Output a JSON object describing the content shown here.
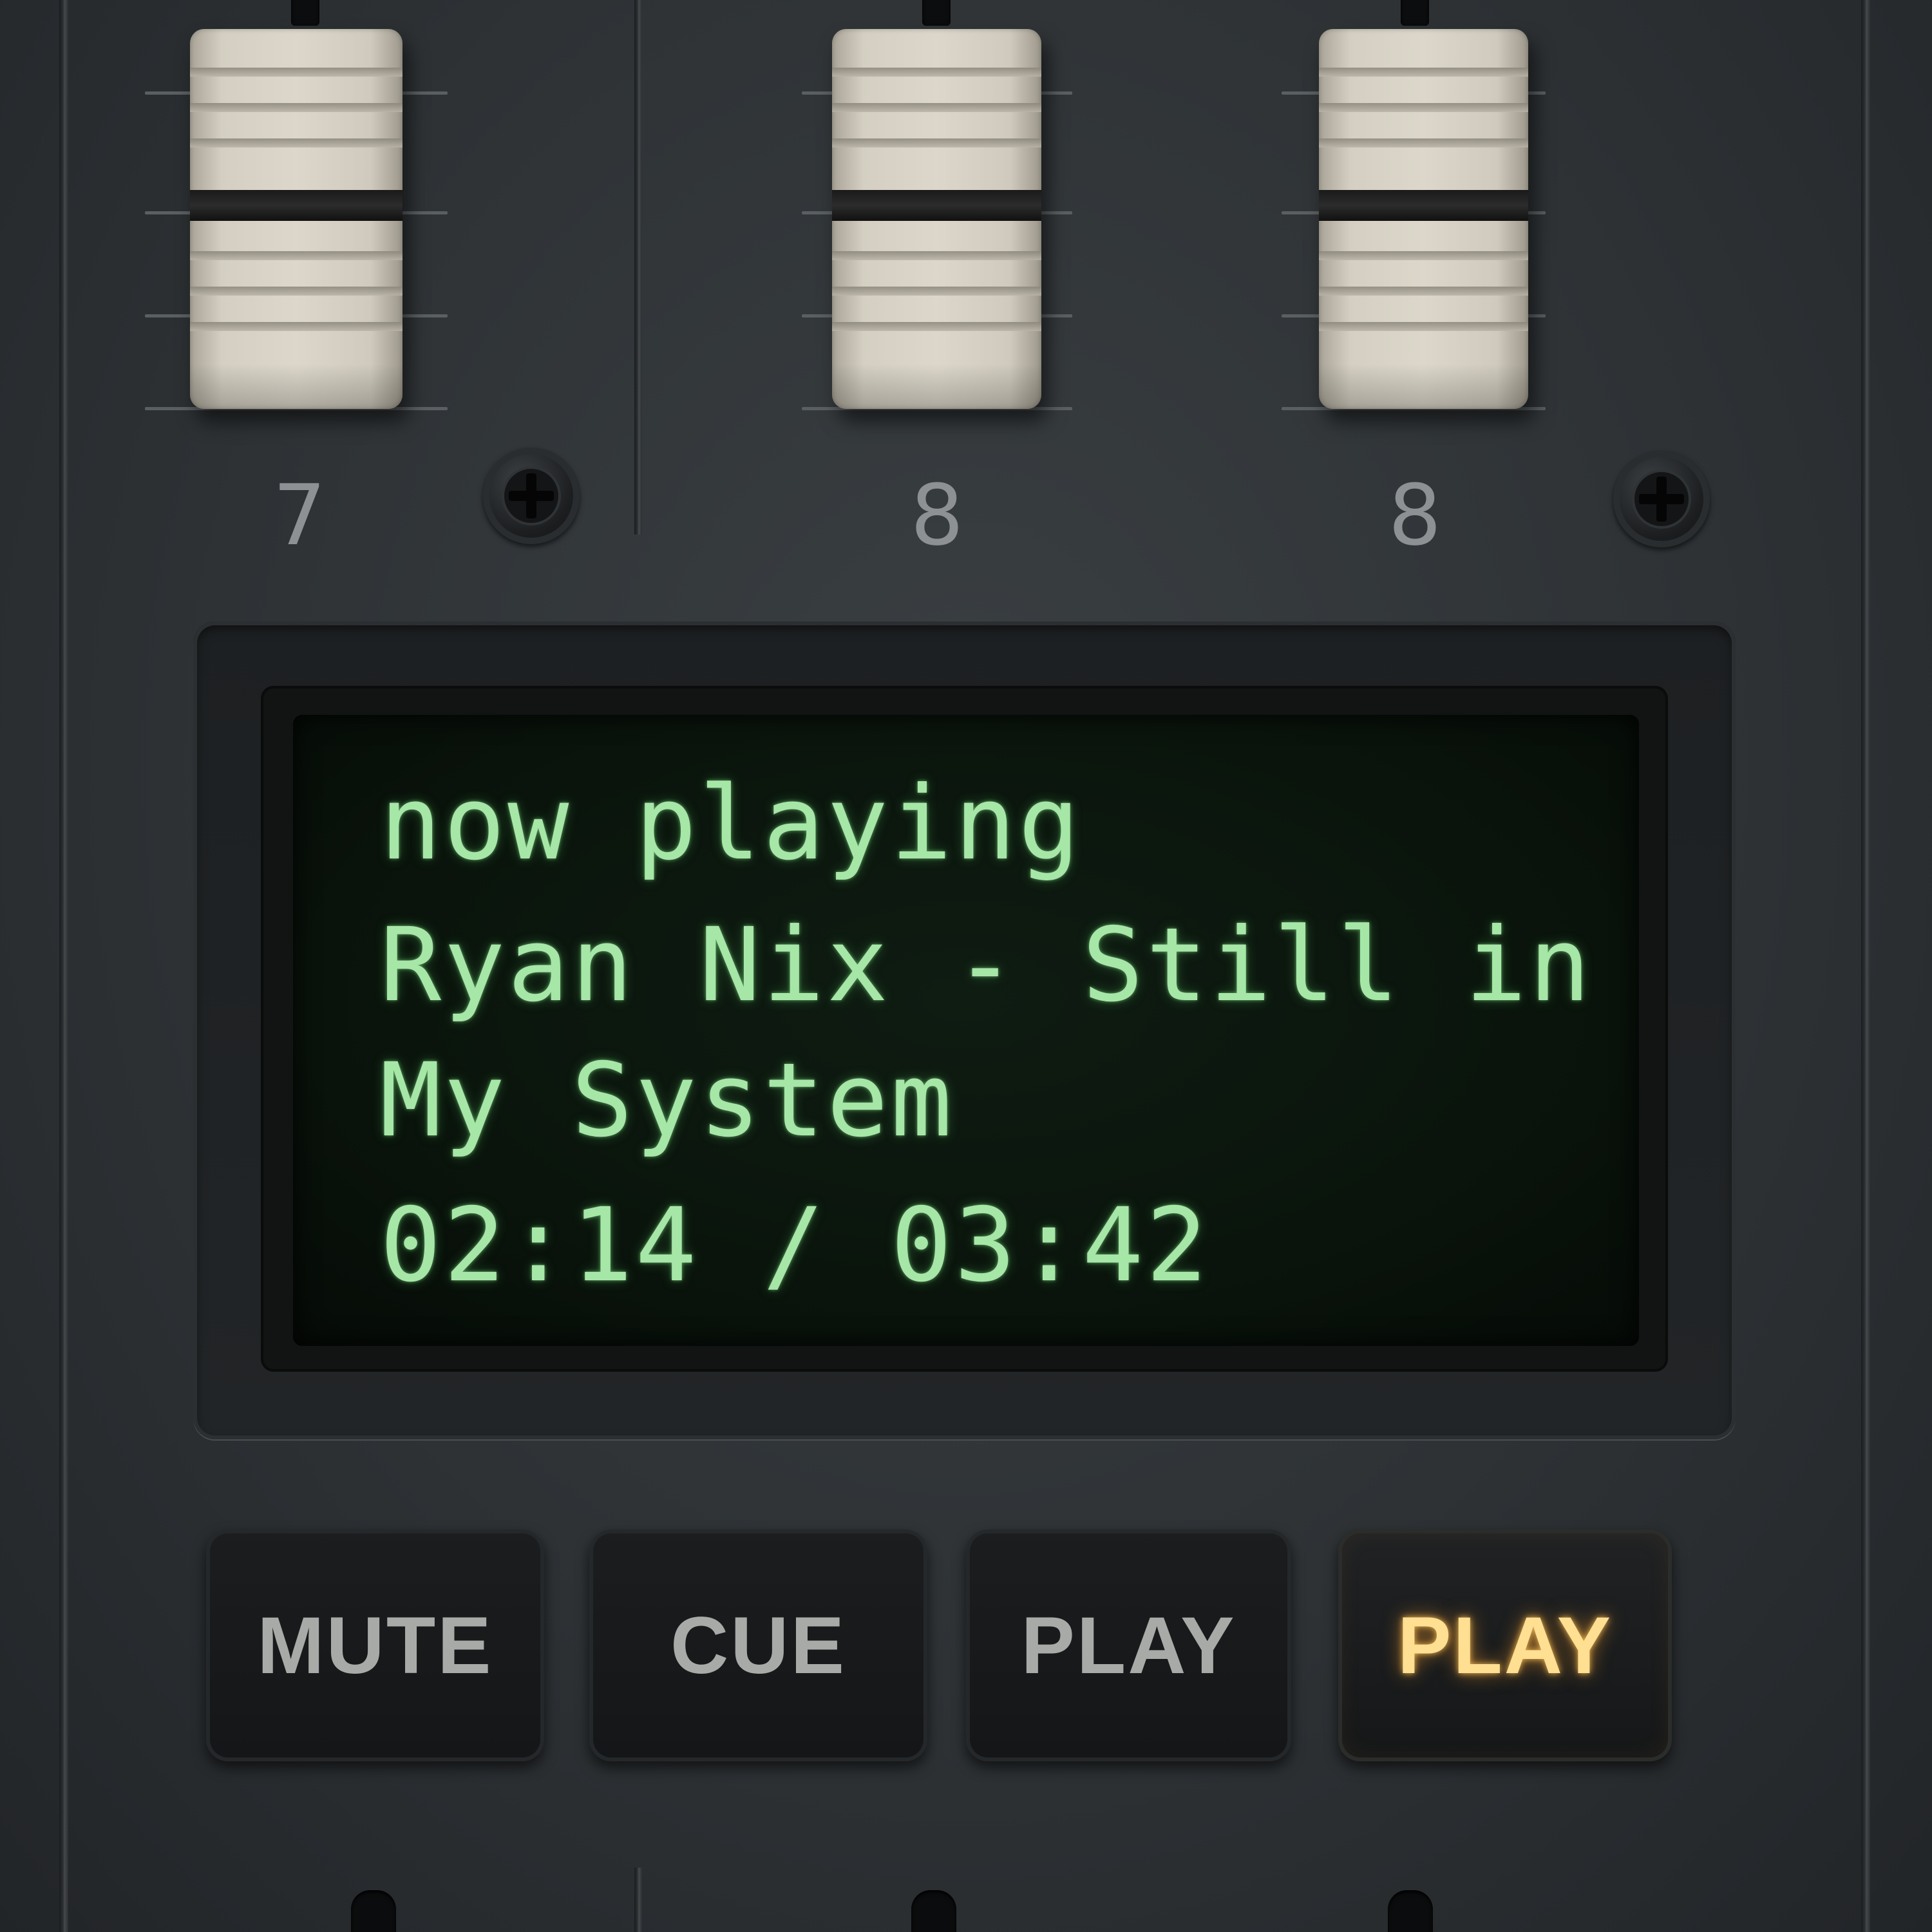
{
  "faders": [
    {
      "id": "fader-1",
      "channel_label": "7"
    },
    {
      "id": "fader-2",
      "channel_label": "8"
    },
    {
      "id": "fader-3",
      "channel_label": "8"
    }
  ],
  "display": {
    "line1": "now playing",
    "line2": "Ryan Nix - Still in",
    "line3": "My System",
    "line4": "02:14 / 03:42",
    "text_color": "#a6e7a8"
  },
  "buttons": [
    {
      "label": "MUTE",
      "active": false
    },
    {
      "label": "CUE",
      "active": false
    },
    {
      "label": "PLAY",
      "active": false
    },
    {
      "label": "PLAY",
      "active": true,
      "glow_color": "#ffdf92"
    }
  ],
  "icons": [
    "screw-icon"
  ]
}
